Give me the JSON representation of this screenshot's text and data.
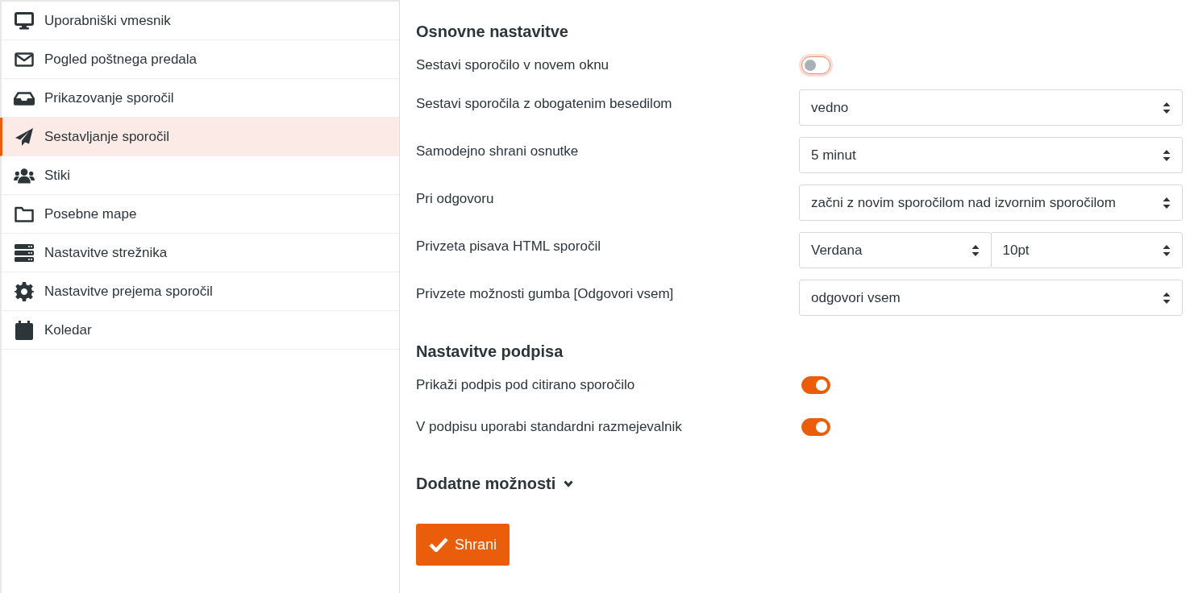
{
  "sidebar": {
    "items": [
      {
        "label": "Uporabniški vmesnik",
        "selected": false
      },
      {
        "label": "Pogled poštnega predala",
        "selected": false
      },
      {
        "label": "Prikazovanje sporočil",
        "selected": false
      },
      {
        "label": "Sestavljanje sporočil",
        "selected": true
      },
      {
        "label": "Stiki",
        "selected": false
      },
      {
        "label": "Posebne mape",
        "selected": false
      },
      {
        "label": "Nastavitve strežnika",
        "selected": false
      },
      {
        "label": "Nastavitve prejema sporočil",
        "selected": false
      },
      {
        "label": "Koledar",
        "selected": false
      }
    ]
  },
  "sections": [
    {
      "title": "Osnovne nastavitve",
      "expanded": true,
      "rows": [
        {
          "kind": "toggle",
          "label": "Sestavi sporočilo v novem oknu",
          "on": false,
          "focused": true
        },
        {
          "kind": "select",
          "label": "Sestavi sporočila z obogatenim besedilom",
          "values": [
            "vedno"
          ]
        },
        {
          "kind": "select",
          "label": "Samodejno shrani osnutke",
          "values": [
            "5 minut"
          ]
        },
        {
          "kind": "select",
          "label": "Pri odgovoru",
          "values": [
            "začni z novim sporočilom nad izvornim sporočilom"
          ]
        },
        {
          "kind": "select",
          "label": "Privzeta pisava HTML sporočil",
          "values": [
            "Verdana",
            "10pt"
          ]
        },
        {
          "kind": "select",
          "label": "Privzete možnosti gumba [Odgovori vsem]",
          "values": [
            "odgovori vsem"
          ]
        }
      ]
    },
    {
      "title": "Nastavitve podpisa",
      "expanded": true,
      "rows": [
        {
          "kind": "toggle",
          "label": "Prikaži podpis pod citirano sporočilo",
          "on": true,
          "focused": false
        },
        {
          "kind": "toggle",
          "label": "V podpisu uporabi standardni razmejevalnik",
          "on": true,
          "focused": false
        }
      ]
    },
    {
      "title": "Dodatne možnosti",
      "expanded": false
    }
  ],
  "save_button": {
    "label": "Shrani"
  }
}
